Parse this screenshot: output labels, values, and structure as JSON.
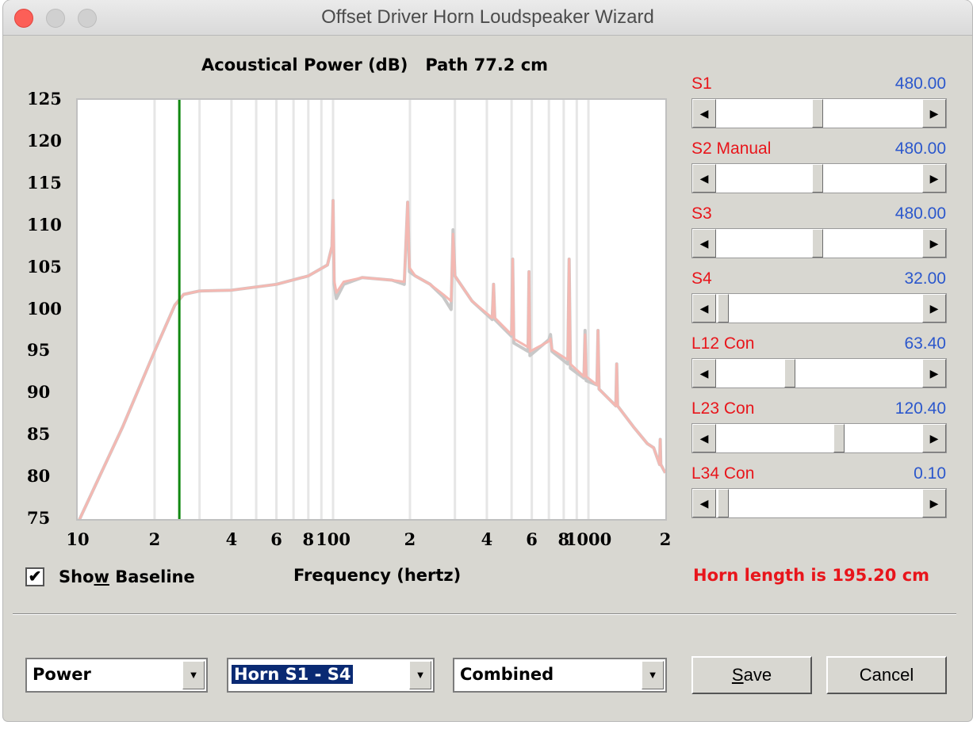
{
  "window": {
    "title": "Offset Driver Horn Loudspeaker Wizard"
  },
  "plot": {
    "title": "Acoustical Power (dB)",
    "path": "Path 77.2 cm"
  },
  "chart_data": {
    "type": "line",
    "title": "Acoustical Power (dB)   Path 77.2 cm",
    "xlabel": "Frequency (hertz)",
    "ylabel": "",
    "xscale": "log",
    "xlim": [
      10,
      2000
    ],
    "ylim": [
      75,
      125
    ],
    "y_ticks": [
      "125",
      "120",
      "115",
      "110",
      "105",
      "100",
      "95",
      "90",
      "85",
      "80",
      "75"
    ],
    "x_ticks": [
      {
        "value": 10,
        "label": "10"
      },
      {
        "value": 20,
        "label": "2"
      },
      {
        "value": 40,
        "label": "4"
      },
      {
        "value": 60,
        "label": "6"
      },
      {
        "value": 80,
        "label": "8"
      },
      {
        "value": 100,
        "label": "100"
      },
      {
        "value": 200,
        "label": "2"
      },
      {
        "value": 400,
        "label": "4"
      },
      {
        "value": 600,
        "label": "6"
      },
      {
        "value": 800,
        "label": "8"
      },
      {
        "value": 1000,
        "label": "1000"
      },
      {
        "value": 2000,
        "label": "2"
      }
    ],
    "grid": true,
    "marker_line": {
      "x": 25,
      "color": "#118811"
    },
    "series": [
      {
        "color": "#c8c8c8",
        "points": [
          [
            10,
            74.5
          ],
          [
            15,
            86
          ],
          [
            20,
            95
          ],
          [
            24,
            100.5
          ],
          [
            26,
            101.8
          ],
          [
            30,
            102.2
          ],
          [
            40,
            102.3
          ],
          [
            60,
            103
          ],
          [
            80,
            104
          ],
          [
            95,
            105.3
          ],
          [
            99,
            107.5
          ],
          [
            100,
            113
          ],
          [
            101,
            103
          ],
          [
            103,
            101.3
          ],
          [
            110,
            103
          ],
          [
            130,
            103.8
          ],
          [
            170,
            103.5
          ],
          [
            190,
            103
          ],
          [
            196,
            112.8
          ],
          [
            199,
            104.5
          ],
          [
            210,
            104
          ],
          [
            240,
            103
          ],
          [
            270,
            101.5
          ],
          [
            290,
            100
          ],
          [
            295,
            109.5
          ],
          [
            300,
            104
          ],
          [
            350,
            101
          ],
          [
            420,
            98.8
          ],
          [
            425,
            103
          ],
          [
            430,
            98.8
          ],
          [
            500,
            96.8
          ],
          [
            505,
            106
          ],
          [
            510,
            96
          ],
          [
            580,
            95
          ],
          [
            585,
            104.5
          ],
          [
            590,
            94.5
          ],
          [
            700,
            96.4
          ],
          [
            710,
            97
          ],
          [
            720,
            95
          ],
          [
            830,
            93.5
          ],
          [
            840,
            106
          ],
          [
            850,
            93
          ],
          [
            960,
            91.8
          ],
          [
            970,
            97.5
          ],
          [
            980,
            91.5
          ],
          [
            1080,
            91
          ],
          [
            1090,
            97.5
          ],
          [
            1100,
            90.5
          ],
          [
            1280,
            88.5
          ],
          [
            1290,
            93.5
          ],
          [
            1300,
            88.5
          ],
          [
            1500,
            86
          ],
          [
            1700,
            84
          ],
          [
            1800,
            83.5
          ],
          [
            1900,
            81.5
          ],
          [
            1910,
            84.5
          ],
          [
            1920,
            81.5
          ],
          [
            2000,
            80.5
          ]
        ]
      },
      {
        "color": "#f4b8b2",
        "points": [
          [
            10,
            74.5
          ],
          [
            15,
            86
          ],
          [
            20,
            95
          ],
          [
            24,
            100.5
          ],
          [
            26,
            101.8
          ],
          [
            30,
            102.2
          ],
          [
            40,
            102.3
          ],
          [
            60,
            103
          ],
          [
            80,
            104
          ],
          [
            95,
            105.3
          ],
          [
            99,
            107.5
          ],
          [
            100,
            113
          ],
          [
            101,
            103.5
          ],
          [
            103,
            102
          ],
          [
            110,
            103.3
          ],
          [
            130,
            103.8
          ],
          [
            170,
            103.5
          ],
          [
            190,
            103.3
          ],
          [
            196,
            112.8
          ],
          [
            199,
            105
          ],
          [
            210,
            104
          ],
          [
            240,
            103
          ],
          [
            270,
            101.8
          ],
          [
            290,
            101
          ],
          [
            295,
            109
          ],
          [
            300,
            104
          ],
          [
            350,
            101
          ],
          [
            420,
            99
          ],
          [
            425,
            103
          ],
          [
            430,
            99
          ],
          [
            500,
            97
          ],
          [
            505,
            106
          ],
          [
            510,
            96.5
          ],
          [
            580,
            95.5
          ],
          [
            585,
            104.5
          ],
          [
            590,
            95
          ],
          [
            700,
            96.2
          ],
          [
            710,
            96.5
          ],
          [
            720,
            95.2
          ],
          [
            830,
            94
          ],
          [
            840,
            106
          ],
          [
            850,
            93.5
          ],
          [
            960,
            92
          ],
          [
            970,
            97
          ],
          [
            980,
            92
          ],
          [
            1080,
            91
          ],
          [
            1090,
            97.5
          ],
          [
            1100,
            90.5
          ],
          [
            1280,
            88.5
          ],
          [
            1290,
            93.5
          ],
          [
            1300,
            88.5
          ],
          [
            1500,
            86
          ],
          [
            1700,
            84
          ],
          [
            1800,
            83.5
          ],
          [
            1900,
            81.5
          ],
          [
            1910,
            84.5
          ],
          [
            1920,
            81.5
          ],
          [
            2000,
            80.5
          ]
        ]
      }
    ]
  },
  "show_baseline": {
    "label_pre": "Sho",
    "label_u": "w",
    "label_post": " Baseline",
    "checked_glyph": "✔"
  },
  "sliders": [
    {
      "name": "S1",
      "value": "480.00",
      "level": 0.48
    },
    {
      "name": "S2  Manual",
      "value": "480.00",
      "level": 0.48
    },
    {
      "name": "S3",
      "value": "480.00",
      "level": 0.48
    },
    {
      "name": "S4",
      "value": "32.00",
      "level": 0.0
    },
    {
      "name": "L12  Con",
      "value": "63.40",
      "level": 0.34
    },
    {
      "name": "L23  Con",
      "value": "120.40",
      "level": 0.59
    },
    {
      "name": "L34  Con",
      "value": "0.10",
      "level": 0.0
    }
  ],
  "horn_length": "Horn length is 195.20 cm",
  "combos": {
    "mode": "Power",
    "horn": "Horn S1 - S4",
    "view": "Combined"
  },
  "buttons": {
    "save": "Save",
    "cancel": "Cancel"
  },
  "glyphs": {
    "left": "◀",
    "right": "▶",
    "down": "▼"
  }
}
